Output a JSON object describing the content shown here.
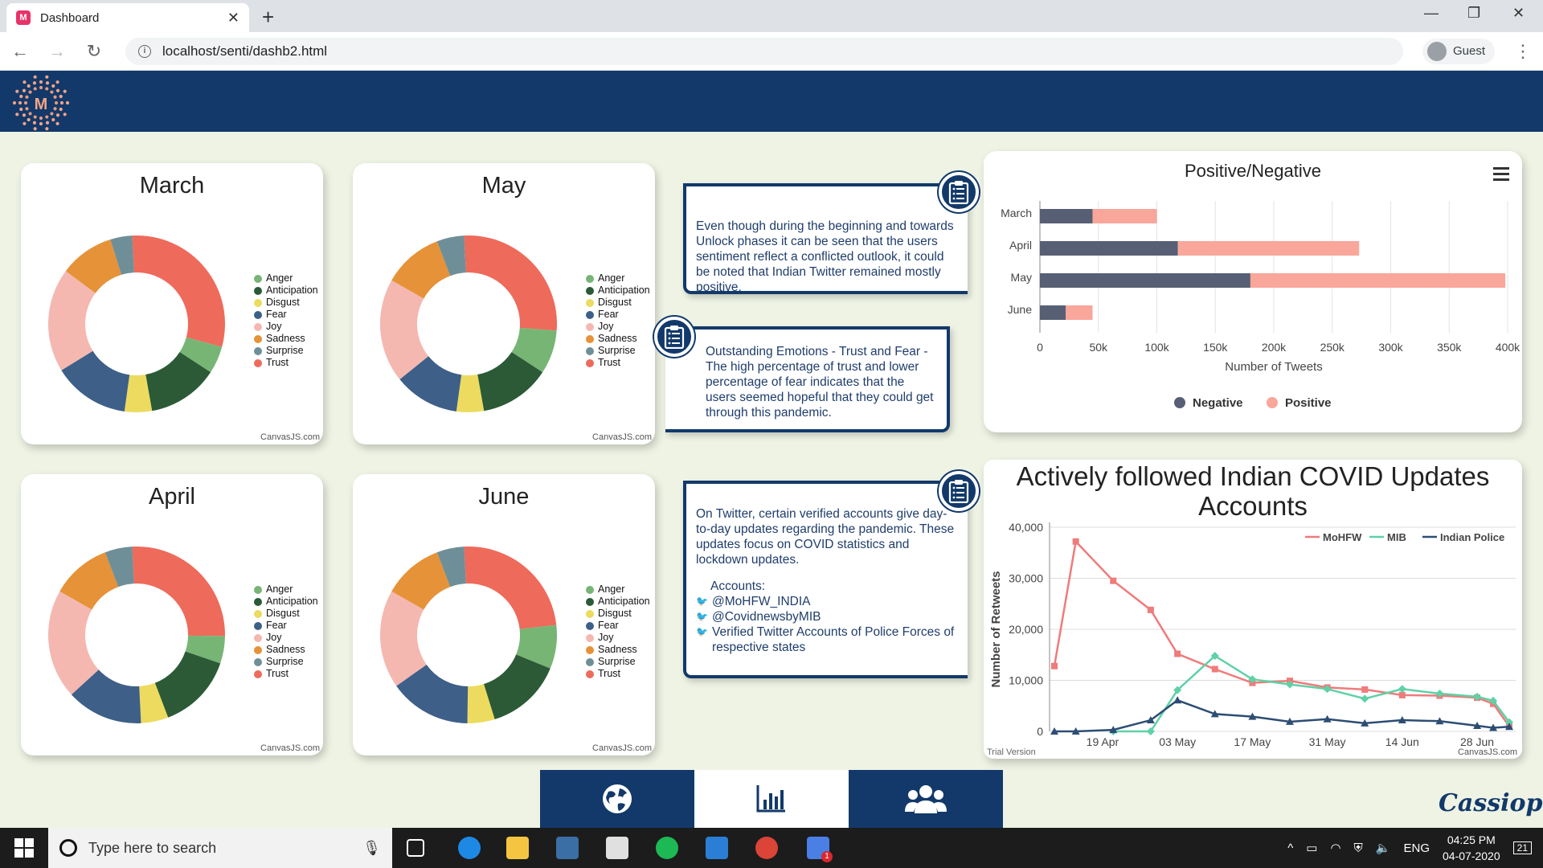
{
  "browser": {
    "tab_title": "Dashboard",
    "favicon_letter": "M",
    "url": "localhost/senti/dashb2.html",
    "profile": "Guest"
  },
  "colors": {
    "header": "#12396a",
    "page_bg": "#eef3e4",
    "anger": "#77b575",
    "anticipation": "#2c5a37",
    "disgust": "#ecdb5f",
    "fear": "#3e5f88",
    "joy": "#f4b8b1",
    "sadness": "#e69238",
    "surprise": "#6f8f98",
    "trust": "#ee6a5b",
    "negative": "#575f74",
    "positive": "#f9a69b",
    "mohfw": "#ef7b7b",
    "mib": "#5fd1a6",
    "police": "#2d4d73"
  },
  "donut_legend": [
    "Anger",
    "Anticipation",
    "Disgust",
    "Fear",
    "Joy",
    "Sadness",
    "Surprise",
    "Trust"
  ],
  "donuts": [
    {
      "title": "March",
      "values": [
        5,
        13,
        5,
        14,
        19,
        10,
        4,
        30
      ]
    },
    {
      "title": "May",
      "values": [
        8,
        13,
        5,
        12,
        19,
        11,
        5,
        27
      ]
    },
    {
      "title": "April",
      "values": [
        5,
        14,
        5,
        14,
        20,
        11,
        5,
        26
      ]
    },
    {
      "title": "June",
      "values": [
        8,
        14,
        5,
        15,
        18,
        11,
        5,
        24
      ]
    }
  ],
  "credit": "CanvasJS.com",
  "notes": {
    "note1": "Even though during the beginning and towards Unlock phases it can be seen that the users sentiment reflect a conflicted outlook, it could be noted that Indian Twitter remained mostly positive.",
    "note2": "Outstanding Emotions - Trust and Fear - The high percentage of trust and lower percentage of fear indicates that the users seemed hopeful that they could get through this pandemic.",
    "note3": "On Twitter, certain verified accounts give day-to-day updates regarding the pandemic. These updates focus on COVID statistics and lockdown updates.",
    "accounts_label": "Accounts:",
    "accounts": [
      "@MoHFW_INDIA",
      "@CovidnewsbyMIB",
      "Verified Twitter Accounts of Police Forces of respective states"
    ]
  },
  "chart_data": [
    {
      "type": "bar",
      "title": "Positive/Negative",
      "categories": [
        "March",
        "April",
        "May",
        "June"
      ],
      "series": [
        {
          "name": "Negative",
          "values": [
            45000,
            118000,
            180000,
            22000
          ]
        },
        {
          "name": "Positive",
          "values": [
            55000,
            155000,
            218000,
            23000
          ]
        }
      ],
      "stacked": true,
      "orientation": "horizontal",
      "xlabel": "Number of Tweets",
      "xlim": [
        0,
        400000
      ],
      "xticks": [
        "0",
        "50k",
        "100k",
        "150k",
        "200k",
        "250k",
        "300k",
        "350k",
        "400k"
      ],
      "legend": "bottom"
    },
    {
      "type": "line",
      "title": "Actively followed Indian COVID Updates Accounts",
      "ylabel": "Number of Retweets",
      "ylim": [
        0,
        40000
      ],
      "yticks": [
        "0",
        "10,000",
        "20,000",
        "30,000",
        "40,000"
      ],
      "xticks": [
        "19 Apr",
        "03 May",
        "17 May",
        "31 May",
        "14 Jun",
        "28 Jun"
      ],
      "x": [
        "2020-04-10",
        "2020-04-14",
        "2020-04-21",
        "2020-04-28",
        "2020-05-03",
        "2020-05-10",
        "2020-05-17",
        "2020-05-24",
        "2020-05-31",
        "2020-06-07",
        "2020-06-14",
        "2020-06-21",
        "2020-06-28",
        "2020-07-01",
        "2020-07-04"
      ],
      "series": [
        {
          "name": "MoHFW",
          "values": [
            12800,
            37200,
            29500,
            23800,
            15200,
            12200,
            9500,
            9900,
            8600,
            8200,
            7100,
            7000,
            6600,
            5400,
            1000
          ]
        },
        {
          "name": "MIB",
          "values": [
            null,
            null,
            0,
            0,
            8100,
            14800,
            10200,
            9200,
            8300,
            6400,
            8300,
            7400,
            6800,
            6000,
            1800
          ]
        },
        {
          "name": "Indian Police",
          "values": [
            0,
            0,
            300,
            2200,
            6100,
            3400,
            2900,
            1900,
            2400,
            1600,
            2200,
            2000,
            1100,
            700,
            900
          ]
        }
      ],
      "legend": "top-right",
      "watermark_left": "Trial Version",
      "watermark_right": "CanvasJS.com"
    }
  ],
  "taskbar": {
    "search_placeholder": "Type here to search",
    "lang": "ENG",
    "time": "04:25 PM",
    "date": "04-07-2020",
    "notif_count": "21",
    "chrome_badge": "1"
  },
  "brand": "Cassiopeia"
}
